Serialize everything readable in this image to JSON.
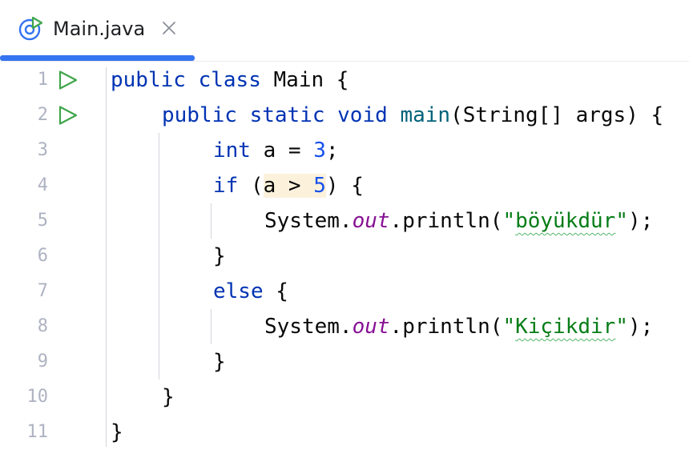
{
  "tab": {
    "title": "Main.java",
    "close_icon": "close-icon",
    "file_icon": "java-class-run-icon",
    "underline_color": "#3574f0"
  },
  "gutter": {
    "line_numbers": [
      "1",
      "2",
      "3",
      "4",
      "5",
      "6",
      "7",
      "8",
      "9",
      "10",
      "11"
    ],
    "run_icon": "run-triangle-icon"
  },
  "code": {
    "line1": {
      "t1": "public",
      "t2": " ",
      "t3": "class",
      "t4": " Main {"
    },
    "line2": {
      "t1": "public",
      "t2": " ",
      "t3": "static",
      "t4": " ",
      "t5": "void",
      "t6": " ",
      "t7": "main",
      "t8": "(String[] args) {"
    },
    "line3": {
      "t1": "int",
      "t2": " a = ",
      "t3": "3",
      "t4": ";"
    },
    "line4": {
      "t1": "if",
      "t2": " (",
      "t3": "a > ",
      "t4": "5",
      "t5": ") {"
    },
    "line5": {
      "t1": "System.",
      "t2": "out",
      "t3": ".println(",
      "t4": "\"",
      "t5": "böyükdür",
      "t6": "\"",
      "t7": ");"
    },
    "line6": {
      "t1": "}"
    },
    "line7": {
      "t1": "else",
      "t2": " {"
    },
    "line8": {
      "t1": "System.",
      "t2": "out",
      "t3": ".println(",
      "t4": "\"",
      "t5": "Kiçikdir",
      "t6": "\"",
      "t7": ");"
    },
    "line9": {
      "t1": "}"
    },
    "line10": {
      "t1": "}"
    },
    "line11": {
      "t1": "}"
    }
  },
  "colors": {
    "keyword": "#0033b3",
    "method": "#00627a",
    "number": "#1750eb",
    "string": "#067d17",
    "static_field": "#871094",
    "highlight": "#fcf2dc",
    "line_number": "#aeb3c2"
  }
}
